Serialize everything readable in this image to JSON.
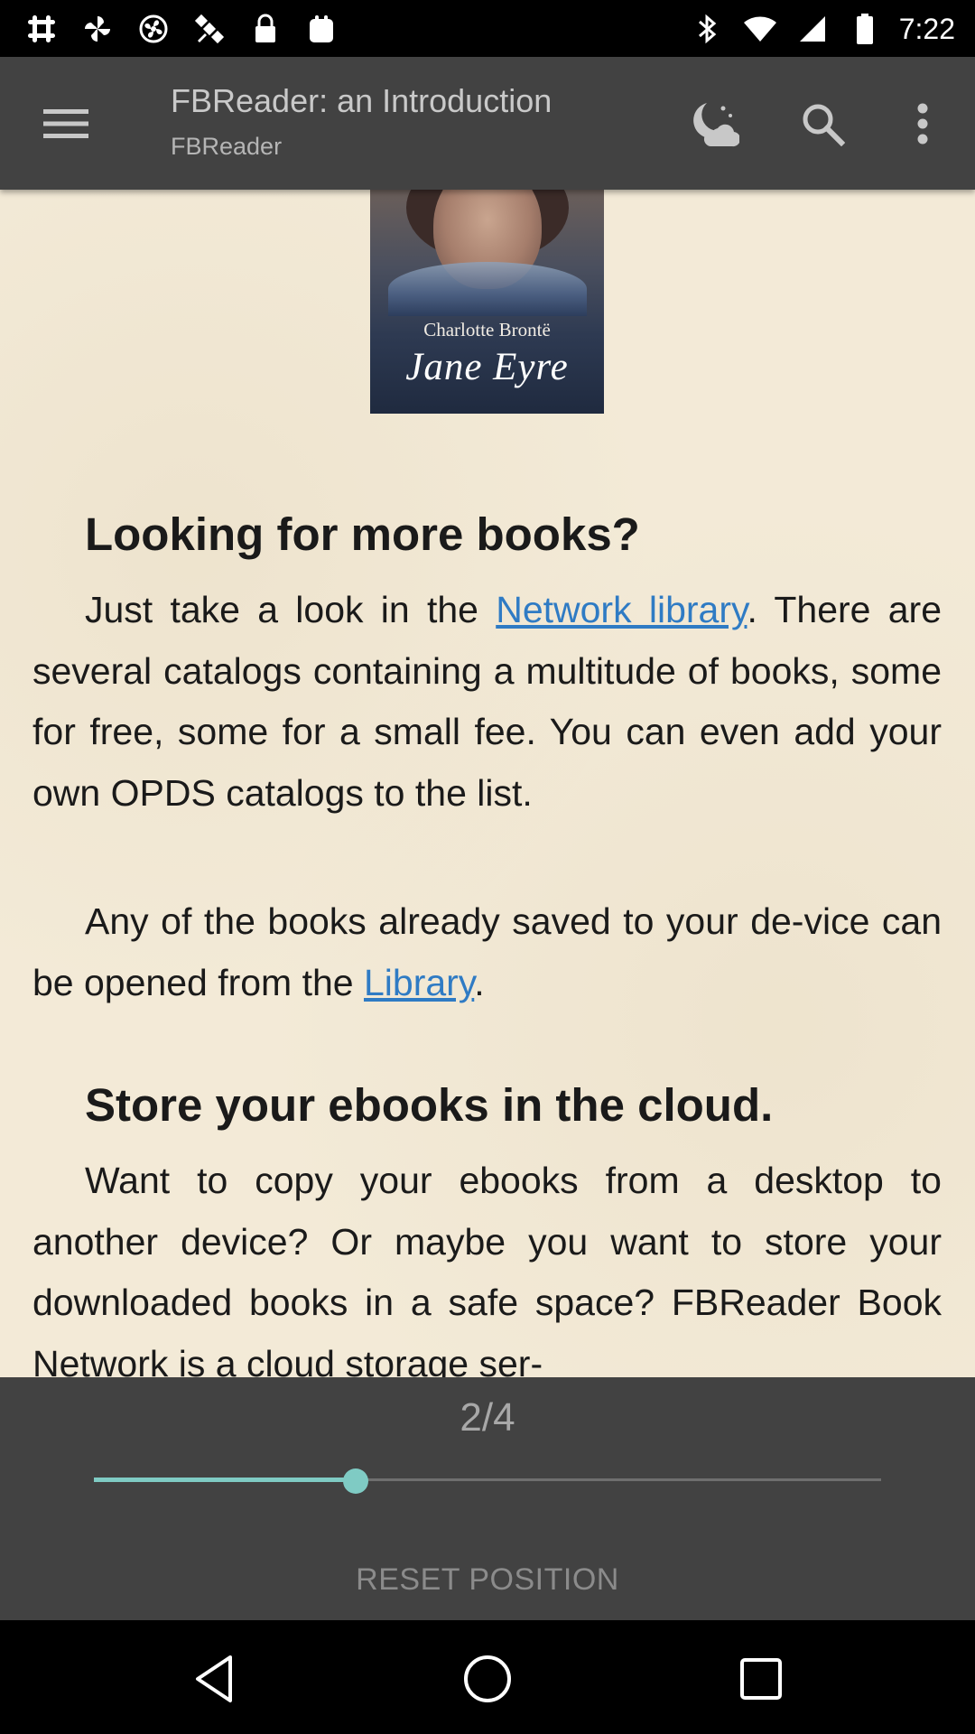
{
  "status_bar": {
    "time": "7:22",
    "left_icons": [
      "slack-icon",
      "pinwheel-icon",
      "fan-icon",
      "satellite-icon",
      "lock-icon",
      "clipboard-icon"
    ],
    "right_icons": [
      "bluetooth-icon",
      "wifi-icon",
      "signal-icon",
      "battery-icon"
    ]
  },
  "app_bar": {
    "title": "FBReader: an Introduction",
    "subtitle": "FBReader",
    "icons": [
      "menu-icon",
      "night-mode-icon",
      "search-icon",
      "more-vert-icon"
    ]
  },
  "cover": {
    "author": "Charlotte Brontë",
    "title": "Jane Eyre"
  },
  "content": {
    "heading1": "Looking for more books?",
    "p1_before": "Just take a look in the ",
    "p1_link": "Network library",
    "p1_after": ". There are several catalogs containing a multitude of books, some for free, some for a small fee. You can even add your own OPDS catalogs to the list.",
    "p2_before": "Any of the books already saved to your de-vice can be opened from the ",
    "p2_link": "Library",
    "p2_after": ".",
    "heading2": "Store your ebooks in the cloud.",
    "p3": "Want to copy your ebooks from a desktop to another device? Or maybe you want to store your downloaded books in a safe space? FBReader Book Network is a cloud storage ser-"
  },
  "navigation": {
    "page_indicator": "2/4",
    "current_page": 2,
    "total_pages": 4,
    "slider_position": 0.333,
    "reset_label": "RESET POSITION"
  },
  "colors": {
    "app_bar": "#424242",
    "page_background": "#f3ead7",
    "link": "#2f7bc4",
    "accent": "#7fcbc4"
  },
  "system_nav": [
    "back-icon",
    "home-icon",
    "recents-icon"
  ]
}
